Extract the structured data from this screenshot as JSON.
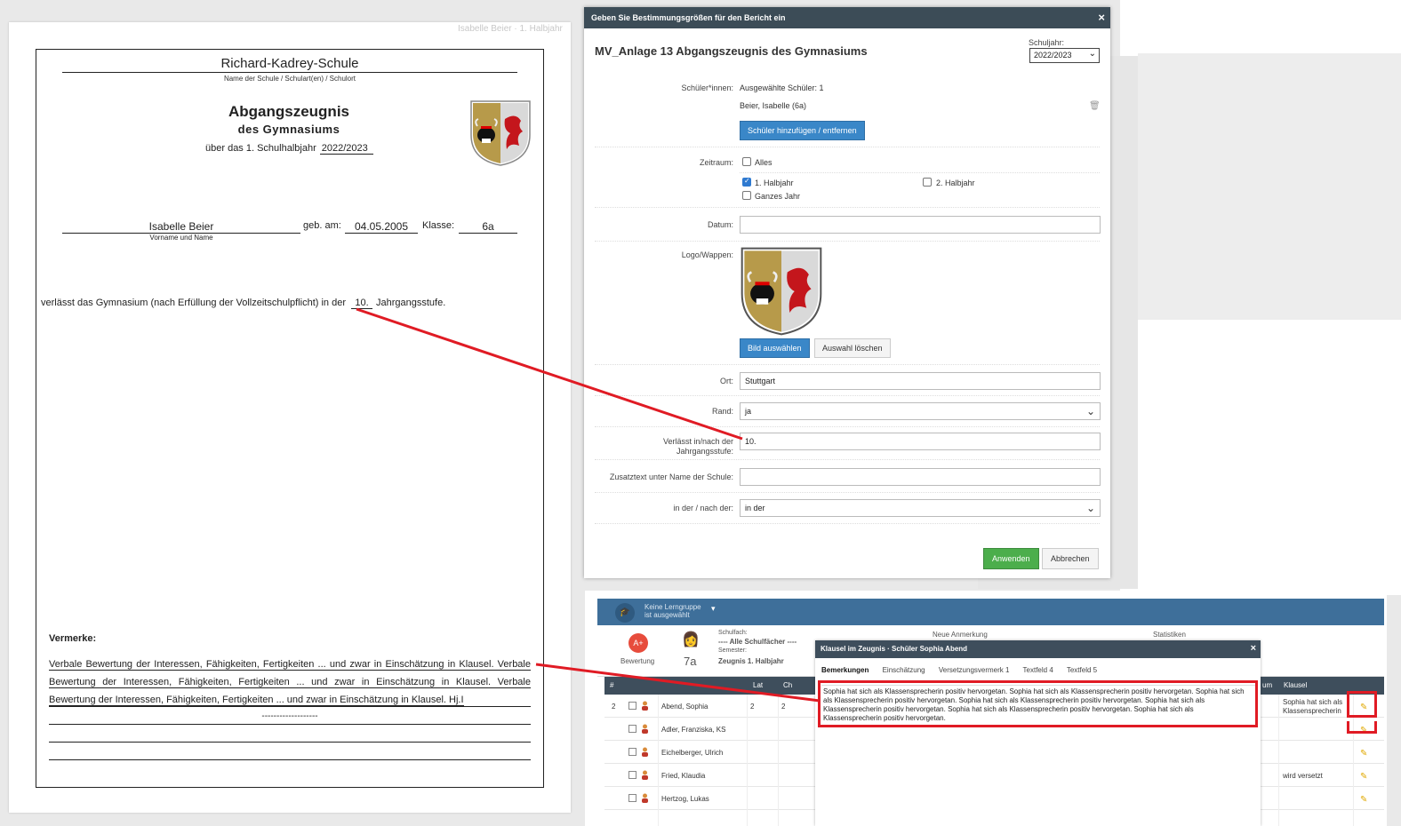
{
  "document": {
    "top_label": "Isabelle Beier · 1. Halbjahr",
    "school_name": "Richard-Kadrey-Schule",
    "school_sub": "Name der Schule / Schulart(en) / Schulort",
    "title": "Abgangszeugnis",
    "subtitle": "des Gymnasiums",
    "period_label": "über das 1. Schulhalbjahr",
    "period_value": "2022/2023",
    "student_name": "Isabelle Beier",
    "student_name_sub": "Vorname und Name",
    "born_label": "geb. am:",
    "born_value": "04.05.2005",
    "class_label": "Klasse:",
    "class_value": "6a",
    "leaves_prefix": "verlässt das Gymnasium (nach Erfüllung der Vollzeitschulpflicht) in der",
    "leaves_value": "10.",
    "leaves_suffix": "Jahrgangsstufe.",
    "remarks_label": "Vermerke:",
    "remarks_text": "Verbale Bewertung der Interessen, Fähigkeiten, Fertigkeiten ... und zwar in Einschätzung in Klausel. Verbale Bewertung der Interessen, Fähigkeiten, Fertigkeiten ... und zwar in Einschätzung in Klausel. Verbale Bewertung der Interessen, Fähigkeiten, Fertigkeiten ... und zwar in Einschätzung in Klausel. Hj.I",
    "dashes": "-------------------"
  },
  "dialog": {
    "header": "Geben Sie Bestimmungsgrößen für den Bericht ein",
    "close": "×",
    "title": "MV_Anlage 13 Abgangszeugnis des Gymnasiums",
    "schuljahr_label": "Schuljahr:",
    "schuljahr_value": "2022/2023",
    "students_label": "Schüler*innen:",
    "students_selected": "Ausgewählte Schüler: 1",
    "student_entry": "Beier, Isabelle (6a)",
    "add_remove_button": "Schüler hinzufügen / entfernen",
    "period_label": "Zeitraum:",
    "opt_all": "Alles",
    "opt_h1": "1. Halbjahr",
    "opt_h2": "2. Halbjahr",
    "opt_year": "Ganzes Jahr",
    "date_label": "Datum:",
    "date_value": "",
    "logo_label": "Logo/Wappen:",
    "choose_image_button": "Bild auswählen",
    "clear_selection_button": "Auswahl löschen",
    "place_label": "Ort:",
    "place_value": "Stuttgart",
    "border_label": "Rand:",
    "border_value": "ja",
    "leaves_label_1": "Verlässt in/nach der",
    "leaves_label_2": "Jahrgangsstufe:",
    "leaves_value": "10.",
    "extra_label": "Zusatztext unter Name der Schule:",
    "extra_value": "",
    "inafter_label": "in der / nach der:",
    "inafter_value": "in der",
    "apply_button": "Anwenden",
    "cancel_button": "Abbrechen"
  },
  "app": {
    "group_line1": "Keine Lerngruppe",
    "group_line2": "ist ausgewählt",
    "rating_label": "Bewertung",
    "class_value": "7a",
    "subject_label": "Schulfach:",
    "subject_value": "---- Alle Schulfächer ----",
    "semester_label": "Semester:",
    "semester_value": "Zeugnis 1. Halbjahr",
    "new_note": "Neue Anmerkung",
    "stats": "Statistiken",
    "col_num": "#",
    "col_lat": "Lat",
    "col_ch": "Ch",
    "col_um": "um",
    "col_klausel": "Klausel",
    "rows": [
      {
        "num": "2",
        "name": "Abend, Sophia",
        "lat": "2",
        "ch": "2",
        "klausel": "Sophia hat sich als Klassensprecherin"
      },
      {
        "num": "",
        "name": "Adler, Franziska, KS",
        "lat": "",
        "ch": "",
        "klausel": ""
      },
      {
        "num": "",
        "name": "Eichelberger, Ulrich",
        "lat": "",
        "ch": "",
        "klausel": ""
      },
      {
        "num": "",
        "name": "Fried, Klaudia",
        "lat": "",
        "ch": "",
        "klausel": "wird versetzt"
      },
      {
        "num": "",
        "name": "Hertzog, Lukas",
        "lat": "",
        "ch": "",
        "klausel": ""
      }
    ],
    "modal_title": "Klausel im Zeugnis · Schüler Sophia Abend",
    "modal_close": "×",
    "tabs": [
      "Bemerkungen",
      "Einschätzung",
      "Versetzungsvermerk 1",
      "Textfeld 4",
      "Textfeld 5"
    ],
    "note_text": "Sophia hat sich als Klassensprecherin positiv hervorgetan. Sophia hat sich als Klassensprecherin positiv hervorgetan. Sophia hat sich als Klassensprecherin positiv hervorgetan. Sophia hat sich als Klassensprecherin positiv hervorgetan. Sophia hat sich als Klassensprecherin positiv hervorgetan. Sophia hat sich als Klassensprecherin positiv hervorgetan. Sophia hat sich als Klassensprecherin positiv hervorgetan."
  },
  "colors": {
    "dialog_header": "#3c4c57",
    "primary_button": "#3a87c8",
    "apply_button": "#4cae4c",
    "annotation": "#e01b24",
    "app_bar": "#3e6f9a"
  }
}
